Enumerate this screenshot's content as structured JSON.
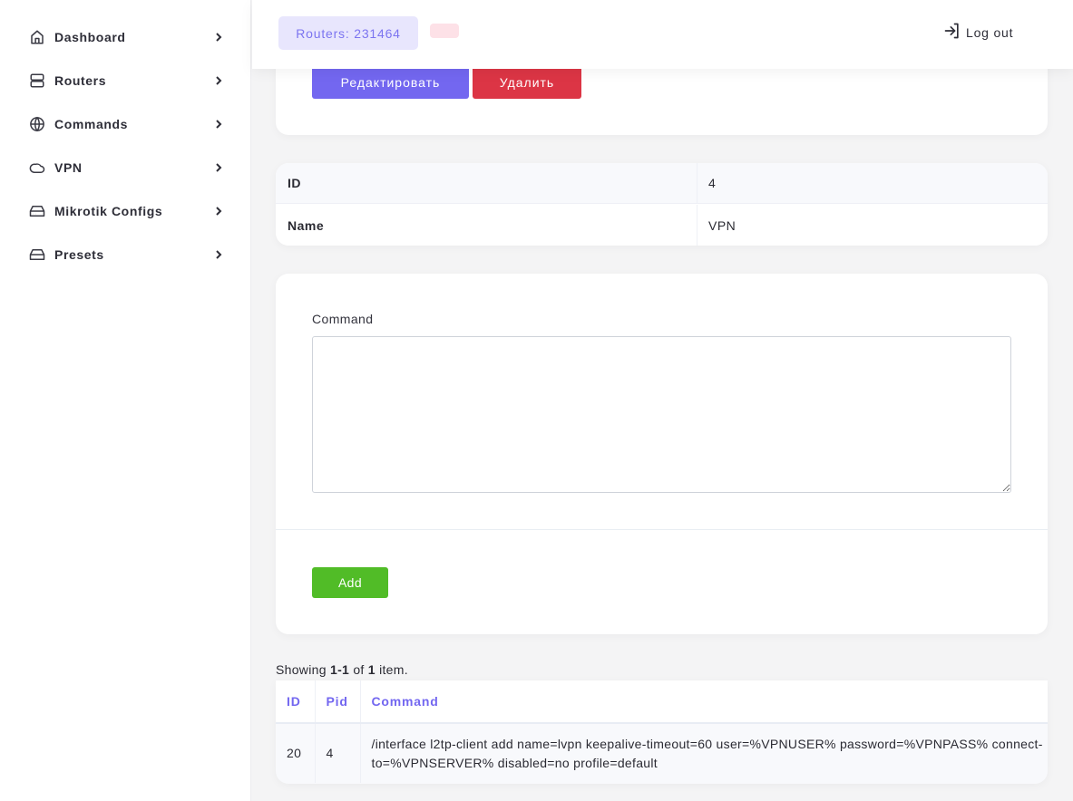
{
  "sidebar": {
    "items": [
      {
        "label": "Dashboard",
        "icon": "home-icon"
      },
      {
        "label": "Routers",
        "icon": "server-icon"
      },
      {
        "label": "Commands",
        "icon": "globe-icon"
      },
      {
        "label": "VPN",
        "icon": "cloud-icon"
      },
      {
        "label": "Mikrotik Configs",
        "icon": "hard-drive-icon"
      },
      {
        "label": "Presets",
        "icon": "hard-drive-icon"
      }
    ]
  },
  "header": {
    "routers_badge": "Routers: 231464",
    "logout_label": "Log out"
  },
  "actions": {
    "edit_label": "Редактировать",
    "delete_label": "Удалить"
  },
  "detail": {
    "rows": [
      {
        "key": "ID",
        "value": "4"
      },
      {
        "key": "Name",
        "value": "VPN"
      }
    ]
  },
  "form": {
    "command_label": "Command",
    "command_value": "",
    "add_label": "Add"
  },
  "summary": {
    "prefix": "Showing ",
    "range": "1-1",
    "mid": " of ",
    "total": "1",
    "suffix": " item."
  },
  "table": {
    "columns": [
      "ID",
      "Pid",
      "Command"
    ],
    "rows": [
      {
        "id": "20",
        "pid": "4",
        "command": "/interface l2tp-client add name=lvpn keepalive-timeout=60 user=%VPNUSER% password=%VPNPASS% connect-to=%VPNSERVER% disabled=no profile=default"
      }
    ]
  },
  "colors": {
    "primary": "#7367f0",
    "danger": "#dc3545",
    "success": "#51bc27",
    "badge_bg": "#e8e6fd",
    "pink_badge_bg": "#fde1e7"
  }
}
